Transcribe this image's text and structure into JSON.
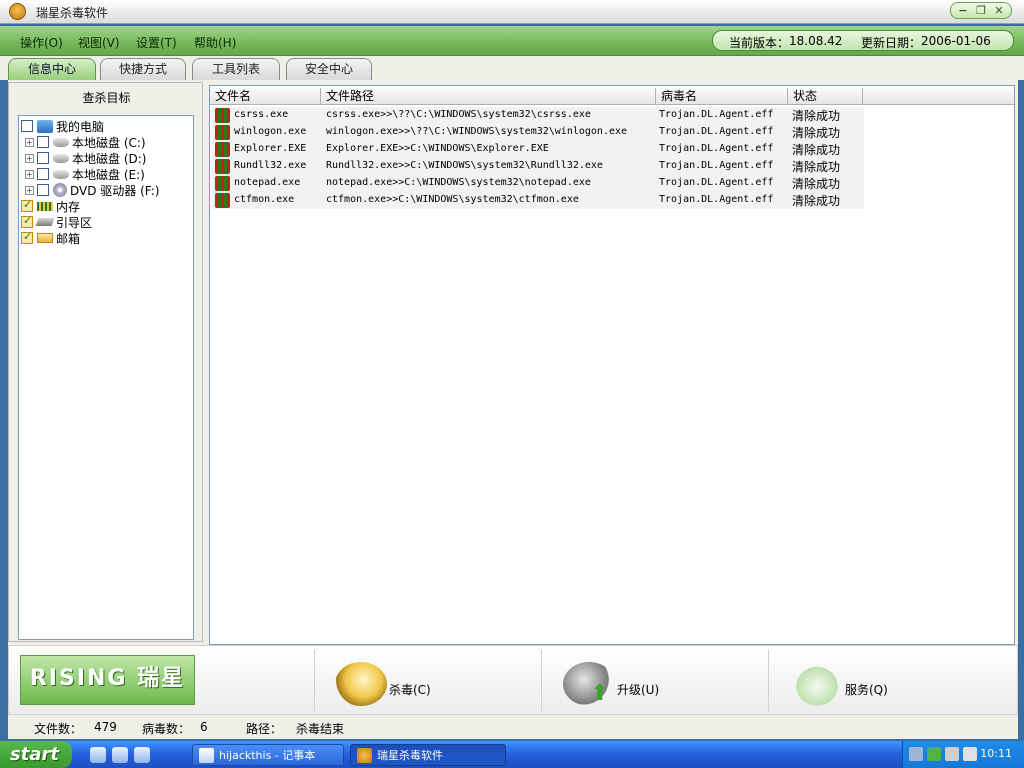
{
  "window": {
    "title": "瑞星杀毒软件"
  },
  "menubar": {
    "items": [
      "操作(O)",
      "视图(V)",
      "设置(T)",
      "帮助(H)"
    ],
    "version_label": "当前版本：",
    "version": "18.08.42",
    "update_label": "更新日期：",
    "update_date": "2006-01-06"
  },
  "tabs": [
    "信息中心",
    "快捷方式",
    "工具列表",
    "安全中心"
  ],
  "left_panel": {
    "header": "查杀目标",
    "tree": [
      {
        "label": "我的电脑",
        "checked": false
      },
      {
        "label": "本地磁盘 (C:)",
        "checked": false
      },
      {
        "label": "本地磁盘 (D:)",
        "checked": false
      },
      {
        "label": "本地磁盘 (E:)",
        "checked": false
      },
      {
        "label": "DVD 驱动器 (F:)",
        "checked": false
      },
      {
        "label": "内存",
        "checked": true
      },
      {
        "label": "引导区",
        "checked": true
      },
      {
        "label": "邮箱",
        "checked": true
      }
    ]
  },
  "list": {
    "columns": [
      "文件名",
      "文件路径",
      "病毒名",
      "状态"
    ],
    "rows": [
      [
        "csrss.exe",
        "csrss.exe>>\\??\\C:\\WINDOWS\\system32\\csrss.exe",
        "Trojan.DL.Agent.eff",
        "清除成功"
      ],
      [
        "winlogon.exe",
        "winlogon.exe>>\\??\\C:\\WINDOWS\\system32\\winlogon.exe",
        "Trojan.DL.Agent.eff",
        "清除成功"
      ],
      [
        "Explorer.EXE",
        "Explorer.EXE>>C:\\WINDOWS\\Explorer.EXE",
        "Trojan.DL.Agent.eff",
        "清除成功"
      ],
      [
        "Rundll32.exe",
        "Rundll32.exe>>C:\\WINDOWS\\system32\\Rundll32.exe",
        "Trojan.DL.Agent.eff",
        "清除成功"
      ],
      [
        "notepad.exe",
        "notepad.exe>>C:\\WINDOWS\\system32\\notepad.exe",
        "Trojan.DL.Agent.eff",
        "清除成功"
      ],
      [
        "ctfmon.exe",
        "ctfmon.exe>>C:\\WINDOWS\\system32\\ctfmon.exe",
        "Trojan.DL.Agent.eff",
        "清除成功"
      ]
    ]
  },
  "actions": {
    "logo_text": "RISING 瑞星",
    "kill": "杀毒(C)",
    "upgrade": "升级(U)",
    "service": "服务(Q)"
  },
  "status": {
    "files_label": "文件数：",
    "files": "479",
    "virus_label": "病毒数：",
    "virus": "6",
    "path_label": "路径：",
    "path": "杀毒结束"
  },
  "taskbar": {
    "start": "start",
    "items": [
      "hijackthis - 记事本",
      "瑞星杀毒软件"
    ],
    "clock": "10:11"
  }
}
